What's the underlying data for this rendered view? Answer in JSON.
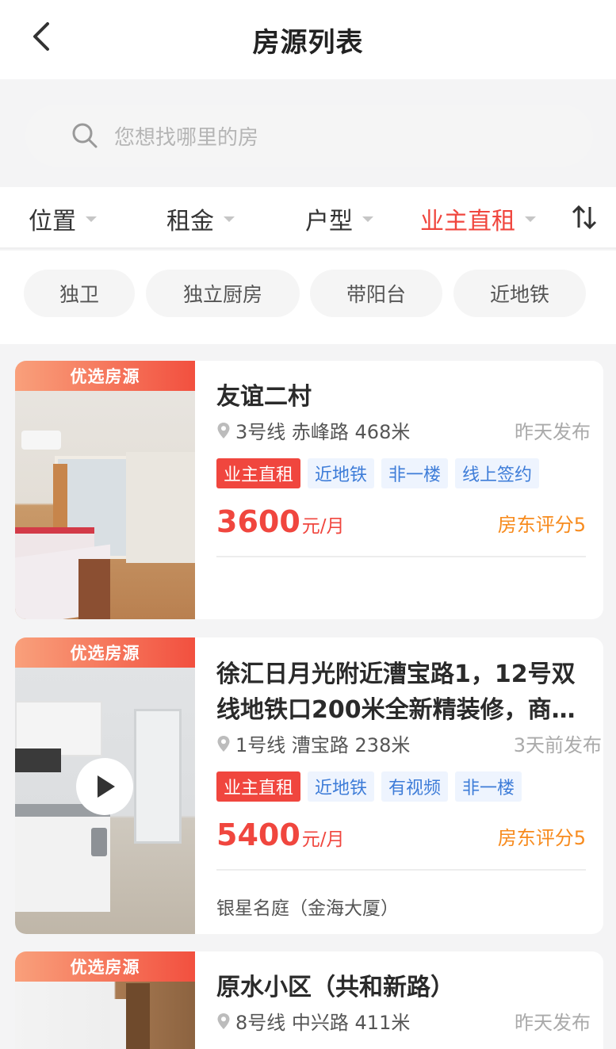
{
  "header": {
    "title": "房源列表"
  },
  "search": {
    "placeholder": "您想找哪里的房"
  },
  "filters": [
    {
      "label": "位置",
      "active": false
    },
    {
      "label": "租金",
      "active": false
    },
    {
      "label": "户型",
      "active": false
    },
    {
      "label": "业主直租",
      "active": true
    }
  ],
  "chips": [
    "独卫",
    "独立厨房",
    "带阳台",
    "近地铁"
  ],
  "listings": [
    {
      "ribbon": "优选房源",
      "title": "友谊二村",
      "location": "3号线 赤峰路 468米",
      "posted": "昨天发布",
      "owner_badge": "业主直租",
      "tags": [
        "近地铁",
        "非一楼",
        "线上签约"
      ],
      "price": "3600",
      "unit": "元/月",
      "score": "房东评分5",
      "community": ""
    },
    {
      "ribbon": "优选房源",
      "title": "徐汇日月光附近漕宝路1，12号双线地铁口200米全新精装修，商…",
      "location": "1号线 漕宝路 238米",
      "posted": "3天前发布",
      "owner_badge": "业主直租",
      "tags": [
        "近地铁",
        "有视频",
        "非一楼"
      ],
      "price": "5400",
      "unit": "元/月",
      "score": "房东评分5",
      "community": "银星名庭（金海大厦）"
    },
    {
      "ribbon": "优选房源",
      "title": "原水小区（共和新路）",
      "location": "8号线 中兴路 411米",
      "posted": "昨天发布"
    }
  ],
  "colors": {
    "accent": "#f0463e",
    "tag_blue": "#3d7cd8",
    "score_orange": "#f78b1e"
  }
}
